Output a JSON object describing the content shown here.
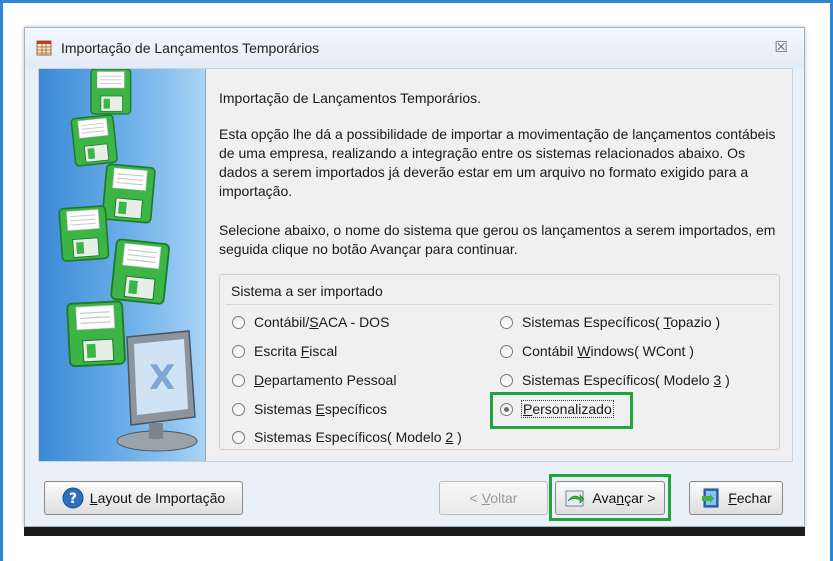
{
  "window": {
    "title": "Importação de Lançamentos Temporários",
    "close_symbol": "☒"
  },
  "intro": {
    "heading": "Importação de Lançamentos Temporários.",
    "description": "Esta opção lhe dá a possibilidade de importar a movimentação de lançamentos contábeis de uma empresa, realizando a integração entre os sistemas relacionados abaixo. Os dados a serem importados já deverão estar em um arquivo no formato exigido para a importação.",
    "instruction": "Selecione abaixo, o nome do sistema que gerou os lançamentos a serem importados, em seguida clique no botão Avançar para continuar."
  },
  "system_group": {
    "title": "Sistema a ser importado",
    "left_options": [
      {
        "pre": "Contábil/",
        "key": "S",
        "post": "ACA - DOS",
        "selected": false
      },
      {
        "pre": "Escrita ",
        "key": "F",
        "post": "iscal",
        "selected": false
      },
      {
        "pre": "",
        "key": "D",
        "post": "epartamento Pessoal",
        "selected": false
      },
      {
        "pre": "Sistemas ",
        "key": "E",
        "post": "specíficos",
        "selected": false
      },
      {
        "pre": "Sistemas Específicos( Modelo ",
        "key": "2",
        "post": " )",
        "selected": false
      }
    ],
    "right_options": [
      {
        "pre": "Sistemas Específicos( ",
        "key": "T",
        "post": "opazio )",
        "selected": false
      },
      {
        "pre": "Contábil ",
        "key": "W",
        "post": "indows( WCont )",
        "selected": false
      },
      {
        "pre": "Sistemas Específicos( Modelo ",
        "key": "3",
        "post": " )",
        "selected": false
      },
      {
        "pre": "",
        "key": "P",
        "post": "ersonalizado",
        "selected": true
      }
    ]
  },
  "buttons": {
    "layout": {
      "pre": "",
      "key": "L",
      "post": "ayout de Importação"
    },
    "back": {
      "pre": "< ",
      "key": "V",
      "post": "oltar"
    },
    "next": {
      "pre": "Ava",
      "key": "n",
      "post": "çar >"
    },
    "close": {
      "pre": "",
      "key": "F",
      "post": "echar"
    }
  },
  "colors": {
    "highlight": "#1fa53a",
    "disk_green": "#3cb446",
    "side_panel": "#3b88d6"
  }
}
